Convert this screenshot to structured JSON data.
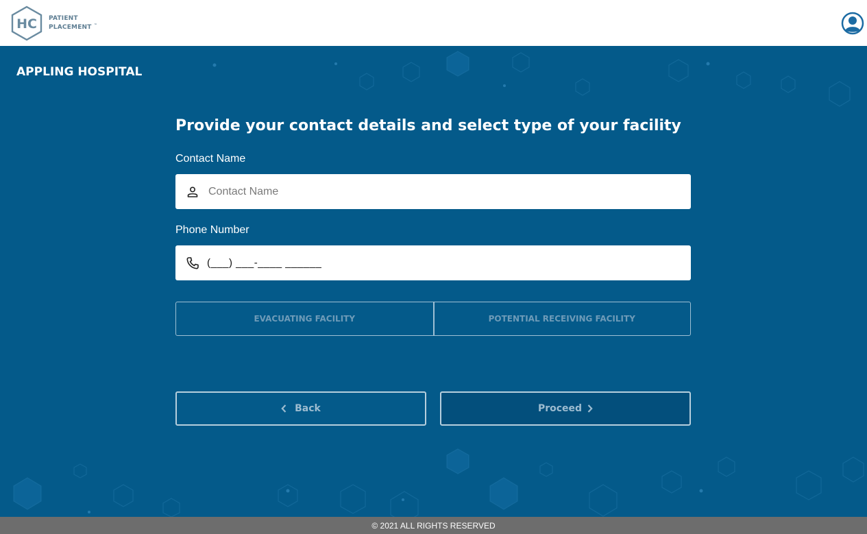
{
  "header": {
    "logo_mark": "HC",
    "logo_line1": "PATIENT",
    "logo_line2": "PLACEMENT",
    "logo_tm": "™",
    "user_icon": "user-circle-icon"
  },
  "facility_name": "APPLING HOSPITAL",
  "form": {
    "heading": "Provide your contact details and select type of your facility",
    "contact_label": "Contact Name",
    "contact_placeholder": "Contact Name",
    "contact_icon": "person-icon",
    "phone_label": "Phone Number",
    "phone_mask": "(___) ___-____ ______",
    "phone_icon": "phone-icon",
    "facility_types": [
      "EVACUATING FACILITY",
      "POTENTIAL RECEIVING FACILITY"
    ]
  },
  "actions": {
    "back_label": "Back",
    "proceed_label": "Proceed"
  },
  "footer": {
    "copyright": "© 2021 ALL RIGHTS RESERVED"
  },
  "colors": {
    "background": "#045a8a",
    "header": "#ffffff",
    "footer": "#6d6d6d",
    "logo": "#5d7d92",
    "button_border": "#b7cfdd"
  }
}
